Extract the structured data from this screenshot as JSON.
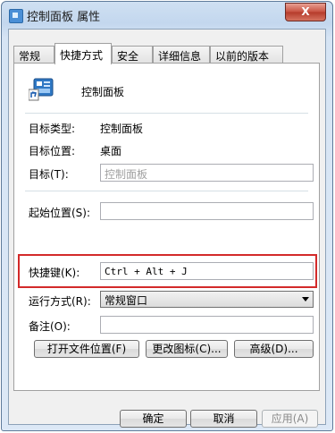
{
  "window": {
    "title": "控制面板 属性",
    "close_glyph": "X"
  },
  "tabs": [
    {
      "label": "常规"
    },
    {
      "label": "快捷方式",
      "active": true
    },
    {
      "label": "安全"
    },
    {
      "label": "详细信息"
    },
    {
      "label": "以前的版本"
    }
  ],
  "shortcut": {
    "name": "控制面板",
    "target_type_label": "目标类型:",
    "target_type_value": "控制面板",
    "target_location_label": "目标位置:",
    "target_location_value": "桌面",
    "target_label": "目标(T):",
    "target_value": "控制面板",
    "start_in_label": "起始位置(S):",
    "start_in_value": "",
    "hotkey_label": "快捷键(K):",
    "hotkey_value": "Ctrl + Alt + J",
    "run_label": "运行方式(R):",
    "run_value": "常规窗口",
    "comment_label": "备注(O):",
    "comment_value": ""
  },
  "actions": {
    "open_location": "打开文件位置(F)",
    "change_icon": "更改图标(C)...",
    "advanced": "高级(D)..."
  },
  "footer": {
    "ok": "确定",
    "cancel": "取消",
    "apply": "应用(A)"
  },
  "colors": {
    "highlight_border": "#d32a2a",
    "close_button": "#c7503f"
  }
}
